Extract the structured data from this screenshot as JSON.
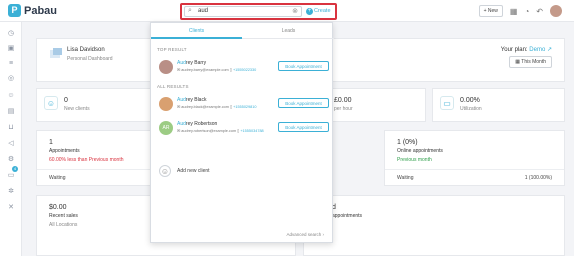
{
  "app": {
    "name": "Pabau"
  },
  "search": {
    "value": "aud",
    "create_label": "Create"
  },
  "topbar": {
    "new_label": "+ New"
  },
  "profile": {
    "name": "Lisa Davidson",
    "subtitle": "Personal Dashboard",
    "plan_label": "Your plan:",
    "plan_name": "Demo",
    "period_label": "This Month"
  },
  "stats": [
    {
      "value": "0",
      "label": "New clients"
    },
    {
      "value": "£0.00",
      "label": "per hour"
    },
    {
      "value": "0.00%",
      "label": "Utilization"
    }
  ],
  "panels": {
    "appointments": {
      "value": "1",
      "label": "Appointments",
      "sub": "60.00% less than Previous month",
      "foot_label": "Waiting"
    },
    "online": {
      "value": "1 (0%)",
      "label": "Online appointments",
      "sub": "Previous month",
      "foot_label": "Waiting",
      "foot_value": "1 (100.00%)"
    },
    "sales": {
      "value": "$0.00",
      "label": "Recent sales",
      "sub": "All Locations"
    },
    "fourth": {
      "value": "d",
      "label": "appointments"
    }
  },
  "dropdown": {
    "tabs": [
      "Clients",
      "Leads"
    ],
    "top_result_label": "TOP RESULT",
    "all_results_label": "ALL RESULTS",
    "book_label": "Book Appointment",
    "results": [
      {
        "name_match": "Aud",
        "name_rest": "rey Barry",
        "email": "audrey.barry@example.com",
        "phone": "+1555022330"
      },
      {
        "name_match": "Aud",
        "name_rest": "rey Black",
        "email": "audrey.black@example.com",
        "phone": "+1555029810"
      },
      {
        "name_match": "Aud",
        "name_rest": "rey Robertson",
        "email": "audrey.robertson@example.com",
        "phone": "+1555034788",
        "initials": "AR"
      }
    ],
    "add_client_label": "Add new client",
    "advanced_label": "Advanced search"
  },
  "colors": {
    "accent": "#3bb0d6",
    "highlight_border": "#d9333f",
    "negative": "#d9333f",
    "positive": "#2e9e4a"
  }
}
